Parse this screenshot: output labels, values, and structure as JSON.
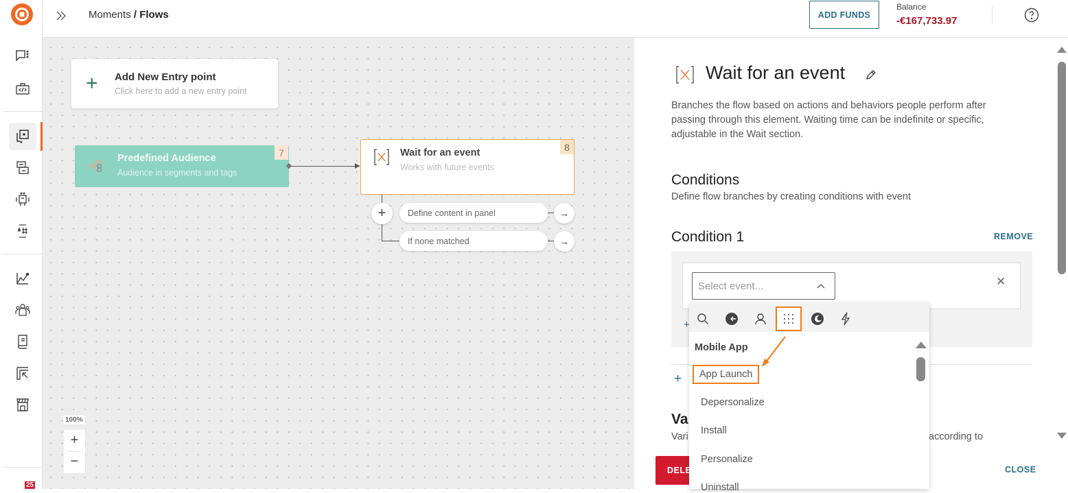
{
  "topbar": {
    "breadcrumb_parent": "Moments",
    "breadcrumb_sep": " / ",
    "breadcrumb_current": "Flows",
    "add_funds_label": "ADD FUNDS",
    "balance_label": "Balance",
    "balance_value": "-€167,733.97"
  },
  "sidebar": {
    "notification_count": "25",
    "items": [
      {
        "name": "conversations",
        "icon": "chat-icon"
      },
      {
        "name": "developer",
        "icon": "code-briefcase-icon"
      },
      {
        "name": "moments",
        "icon": "moments-icon",
        "active": true
      },
      {
        "name": "broadcast",
        "icon": "broadcast-icon"
      },
      {
        "name": "chatbots",
        "icon": "bot-icon"
      },
      {
        "name": "templates",
        "icon": "hash-icon"
      },
      {
        "name": "analyze",
        "icon": "chart-icon"
      },
      {
        "name": "people",
        "icon": "people-icon"
      },
      {
        "name": "docs",
        "icon": "book-icon"
      },
      {
        "name": "exports",
        "icon": "export-icon"
      },
      {
        "name": "store",
        "icon": "store-icon"
      }
    ]
  },
  "canvas": {
    "entry_title": "Add New Entry point",
    "entry_sub": "Click here to add a new entry point",
    "audience_title": "Predefined Audience",
    "audience_sub": "Audience in segments and tags",
    "audience_badge": "7",
    "wait_title": "Wait for an event",
    "wait_sub": "Works with future events",
    "wait_badge": "8",
    "branches": [
      "Define content in panel",
      "If none matched"
    ],
    "zoom_level": "100%"
  },
  "panel": {
    "title": "Wait for an event",
    "description": "Branches the flow based on actions and behaviors people perform after passing through this element. Waiting time can be indefinite or specific, adjustable in the Wait section.",
    "conditions_title": "Conditions",
    "conditions_sub": "Define flow branches by creating conditions with event",
    "condition1_title": "Condition 1",
    "remove_label": "REMOVE",
    "select_placeholder": "Select event...",
    "variables_title_partial": "Va",
    "variables_sub_left": "Vari",
    "variables_sub_right": "according to",
    "delete_label": "DELE",
    "close_label": "CLOSE"
  },
  "dropdown": {
    "tabs": [
      "search-icon",
      "web-icon",
      "person-icon",
      "mobile-app-grid-icon",
      "chat-bubble-icon",
      "flash-icon"
    ],
    "active_tab": 3,
    "group": "Mobile App",
    "items": [
      "App Launch",
      "Depersonalize",
      "Install",
      "Personalize",
      "Uninstall"
    ],
    "highlighted": "App Launch"
  },
  "colors": {
    "brand": "#f26722",
    "accent": "#2a6f8a",
    "danger": "#d21b2f",
    "highlight": "#f07c14"
  }
}
